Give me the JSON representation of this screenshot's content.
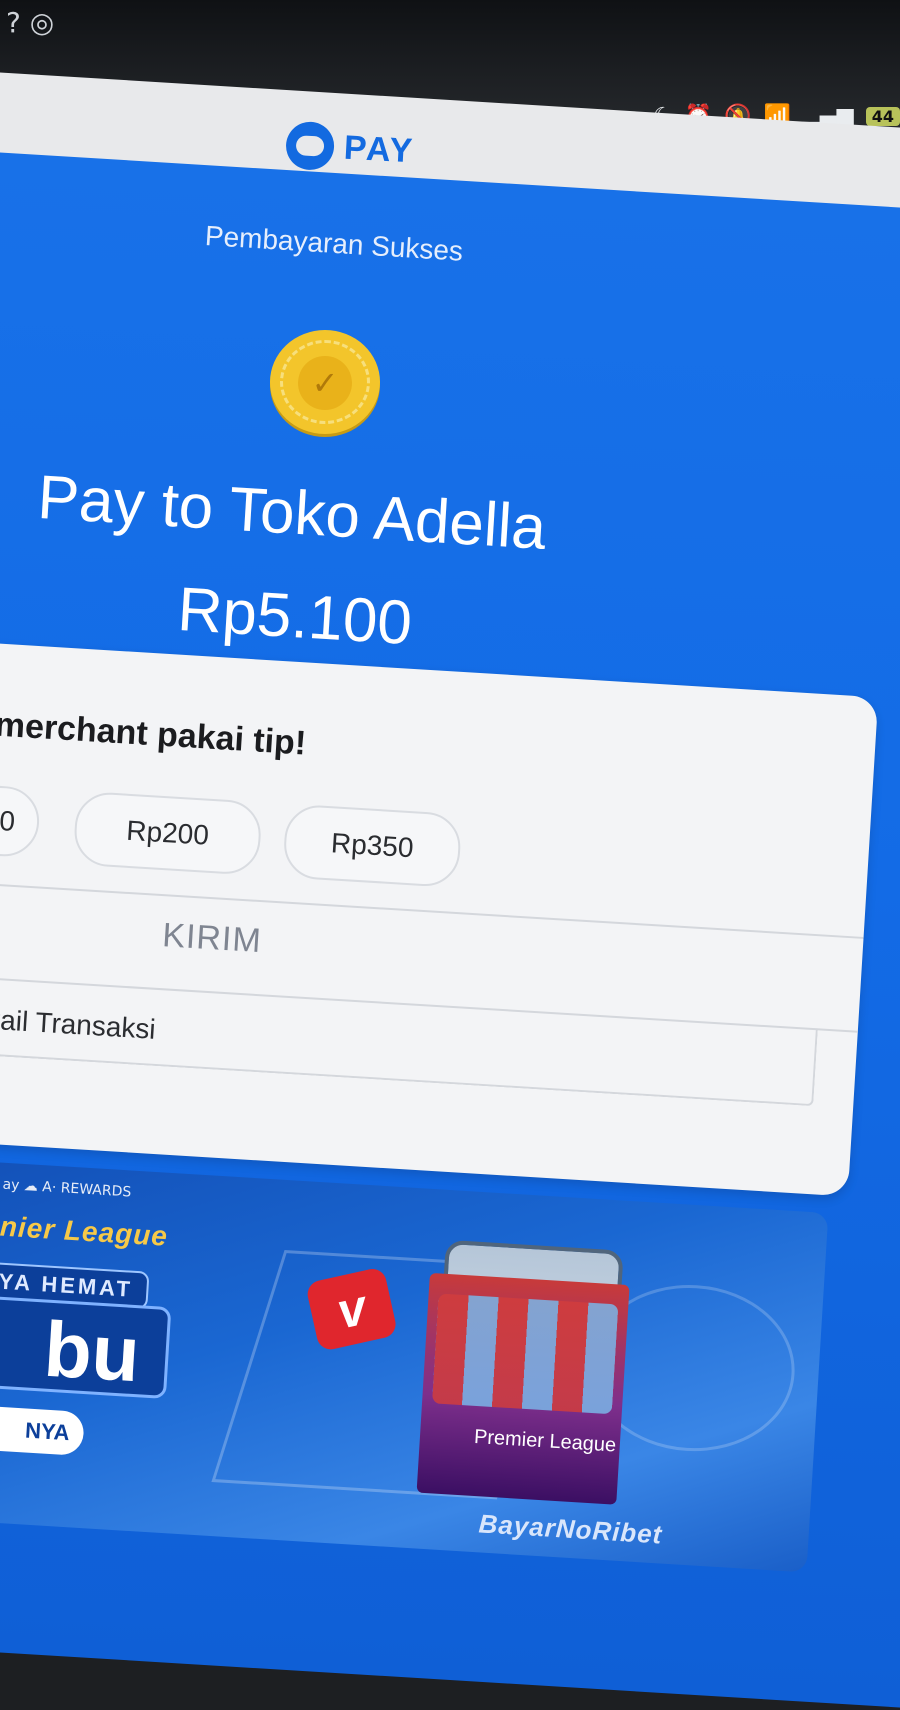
{
  "status_bar": {
    "top_left_glyphs": "? ◎",
    "icons": [
      "moon-icon",
      "alarm-icon",
      "mute-icon",
      "wifi-icon",
      "signal-icon"
    ],
    "battery": "44"
  },
  "app": {
    "logo_text": "PAY",
    "brand_color": "#136ae0"
  },
  "receipt": {
    "status": "Pembayaran Sukses",
    "pay_to": "Pay to Toko Adella",
    "amount": "Rp5.100",
    "success_icon": "check-coin-icon"
  },
  "tip": {
    "title": "merchant pakai tip!",
    "options": [
      "0",
      "Rp200",
      "Rp350"
    ],
    "send_label": "KIRIM",
    "detail_label": "etail Transaksi"
  },
  "banner": {
    "sponsor_line": "ay   ☁ A· REWARDS",
    "league_text": "nier League",
    "promo_line": "YA HEMAT",
    "big_text": "bu",
    "cta_label": "NYA",
    "pl_card_text": "Premier League",
    "hashtag": "BayarNoRibet"
  }
}
